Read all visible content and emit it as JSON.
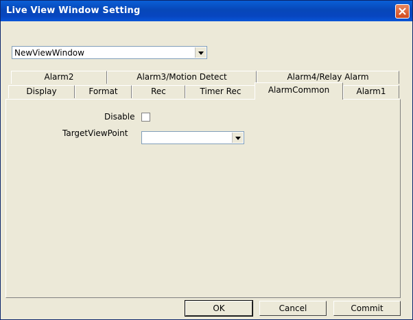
{
  "window": {
    "title": "Live View Window Setting",
    "close_icon": "close-icon"
  },
  "view_select": {
    "value": "NewViewWindow"
  },
  "tabs": {
    "back_row": [
      "Alarm2",
      "Alarm3/Motion Detect",
      "Alarm4/Relay Alarm"
    ],
    "front_row": [
      "Display",
      "Format",
      "Rec",
      "Timer Rec",
      "AlarmCommon",
      "Alarm1"
    ],
    "active": "AlarmCommon"
  },
  "panel": {
    "disable_label": "Disable",
    "disable_checked": false,
    "target_label": "TargetViewPoint",
    "target_value": ""
  },
  "buttons": {
    "ok": "OK",
    "cancel": "Cancel",
    "commit": "Commit"
  },
  "colors": {
    "titlebar": "#0747b8",
    "face": "#ece9d8",
    "close": "#d24a1d"
  }
}
